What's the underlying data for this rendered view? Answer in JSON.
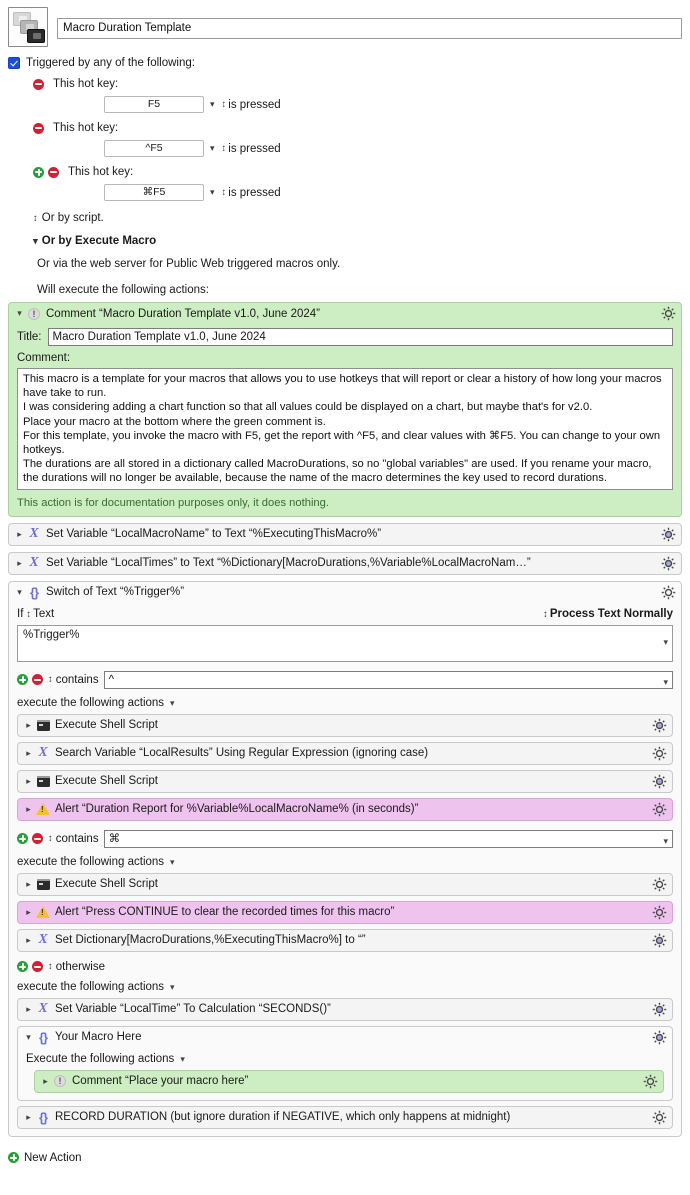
{
  "header": {
    "macro_icon": "macro-stack-icon",
    "macro_name": "Macro Duration Template"
  },
  "triggers": {
    "enabled_label": "Triggered by any of the following:",
    "items": [
      {
        "label": "This hot key:",
        "key": "F5",
        "suffix": "is pressed",
        "has_plus": false
      },
      {
        "label": "This hot key:",
        "key": "^F5",
        "suffix": "is pressed",
        "has_plus": false
      },
      {
        "label": "This hot key:",
        "key": "⌘F5",
        "suffix": "is pressed",
        "has_plus": true
      }
    ],
    "or_script": "Or by script.",
    "or_execute_macro": "Or by Execute Macro",
    "or_web": "Or via the web server for Public Web triggered macros only.",
    "will_execute": "Will execute the following actions:"
  },
  "comment_action": {
    "title_bar": "Comment “Macro Duration Template v1.0, June 2024”",
    "title_label": "Title:",
    "title_value": "Macro Duration Template v1.0, June 2024",
    "comment_label": "Comment:",
    "comment_body": "This macro is a template for your macros that allows you to use hotkeys that will report or clear a history of how long your macros have take to run.\nI was considering adding a chart function so that all values could be displayed on a chart, but maybe that's for v2.0.\nPlace your macro at the bottom where the green comment is.\nFor this template, you invoke the macro with F5, get the report with ^F5, and clear values with ⌘F5. You can change to your own hotkeys.\nThe durations are all stored in a dictionary called MacroDurations, so no \"global variables\" are used. If you rename your macro, the durations will no longer be available, because the name of the macro determines the key used to record durations.",
    "note": "This action is for documentation purposes only, it does nothing."
  },
  "top_actions": [
    {
      "label": "Set Variable “LocalMacroName” to Text “%ExecutingThisMacro%”",
      "icon": "variable-x-icon"
    },
    {
      "label": "Set Variable “LocalTimes” to Text “%Dictionary[MacroDurations,%Variable%LocalMacroNam…”",
      "icon": "variable-x-icon"
    }
  ],
  "switch_action": {
    "title_bar": "Switch of Text “%Trigger%”",
    "if_label": "If",
    "if_kind": "Text",
    "process_label": "Process Text Normally",
    "source_value": "%Trigger%",
    "cases": [
      {
        "operator": "contains",
        "value": "^",
        "exec_label": "execute the following actions",
        "actions": [
          {
            "label": "Execute Shell Script",
            "icon": "terminal-icon",
            "color": "plain"
          },
          {
            "label": "Search Variable “LocalResults” Using Regular Expression (ignoring case)",
            "icon": "variable-x-icon",
            "color": "plain"
          },
          {
            "label": "Execute Shell Script",
            "icon": "terminal-icon",
            "color": "plain"
          },
          {
            "label": "Alert “Duration Report for %Variable%LocalMacroName% (in seconds)”",
            "icon": "alert-warning-icon",
            "color": "pink"
          }
        ]
      },
      {
        "operator": "contains",
        "value": "⌘",
        "exec_label": "execute the following actions",
        "actions": [
          {
            "label": "Execute Shell Script",
            "icon": "terminal-icon",
            "color": "plain"
          },
          {
            "label": "Alert “Press CONTINUE to clear the recorded times for this macro”",
            "icon": "alert-warning-icon",
            "color": "pink"
          },
          {
            "label": "Set Dictionary[MacroDurations,%ExecutingThisMacro%] to “”",
            "icon": "variable-x-icon",
            "color": "plain"
          }
        ]
      }
    ],
    "otherwise": {
      "operator": "otherwise",
      "exec_label": "execute the following actions",
      "actions": [
        {
          "label": "Set Variable “LocalTime” To Calculation “SECONDS()”",
          "icon": "variable-x-icon",
          "color": "plain"
        }
      ],
      "group": {
        "title_bar": "Your Macro Here",
        "exec_label": "Execute the following actions",
        "actions": [
          {
            "label": "Comment “Place your macro here”",
            "icon": "comment-bang-icon",
            "color": "green"
          }
        ]
      },
      "trailing_action": {
        "label": "RECORD DURATION (but ignore duration if NEGATIVE, which only happens at midnight)",
        "icon": "group-braces-icon",
        "color": "plain"
      }
    }
  },
  "footer": {
    "new_action_label": "New Action"
  },
  "colors": {
    "comment_green": "#cdeec2",
    "alert_pink": "#eec3ee",
    "action_gray": "#f2f2f2",
    "accent_purple": "#6f6fd8",
    "checkbox_blue": "#1b4fd8",
    "minus_red": "#cc2233",
    "plus_green": "#2a9d3c",
    "warning_yellow": "#f2c12e"
  }
}
